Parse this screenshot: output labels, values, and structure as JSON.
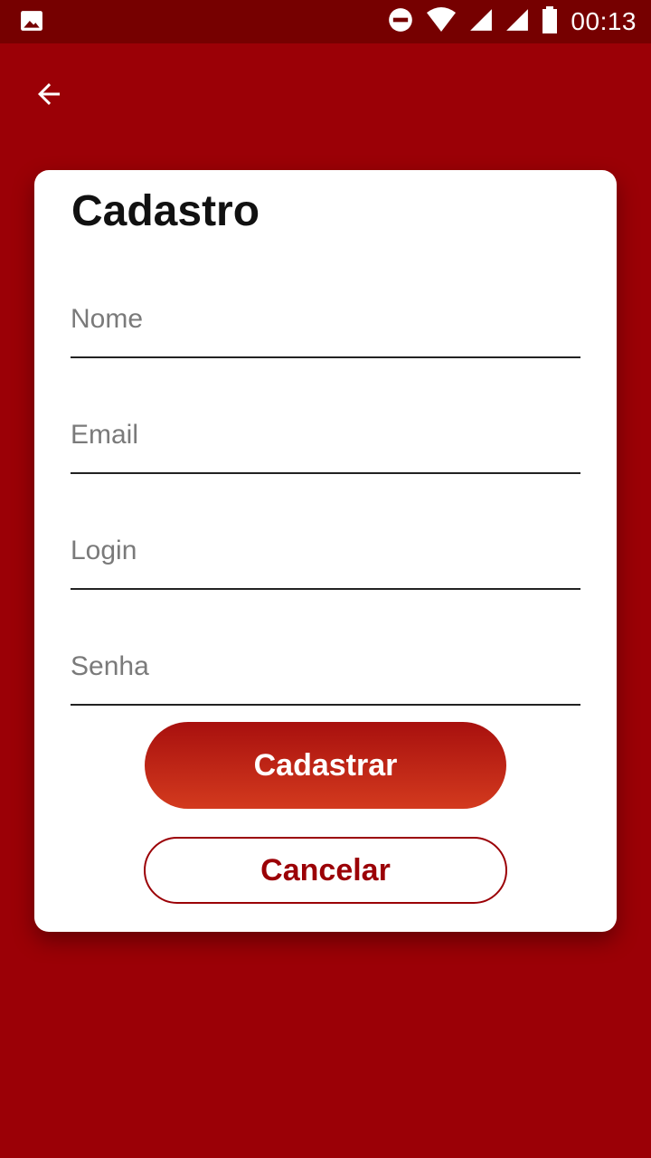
{
  "status_bar": {
    "time": "00:13",
    "icons": [
      "image-icon",
      "do-not-disturb-icon",
      "wifi-icon",
      "signal-icon",
      "signal-icon",
      "battery-icon"
    ]
  },
  "toolbar": {
    "back_icon": "arrow-back-icon"
  },
  "form": {
    "title": "Cadastro",
    "fields": {
      "nome": {
        "placeholder": "Nome",
        "value": ""
      },
      "email": {
        "placeholder": "Email",
        "value": ""
      },
      "login": {
        "placeholder": "Login",
        "value": ""
      },
      "senha": {
        "placeholder": "Senha",
        "value": ""
      }
    },
    "submit_label": "Cadastrar",
    "cancel_label": "Cancelar"
  },
  "colors": {
    "background": "#9b0006",
    "status_bar": "#760000",
    "primary_gradient_top": "#a8100e",
    "primary_gradient_bottom": "#d33a1e",
    "card": "#ffffff"
  }
}
